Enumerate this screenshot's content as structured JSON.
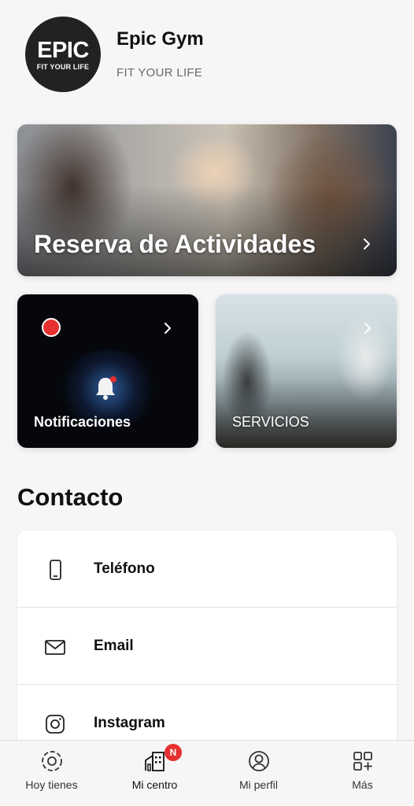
{
  "header": {
    "logo_main": "EPIC",
    "logo_sub": "FIT YOUR LIFE",
    "gym_name": "Epic Gym",
    "tagline": "FIT YOUR LIFE"
  },
  "cards": {
    "reserva": {
      "title": "Reserva de Actividades"
    },
    "notificaciones": {
      "title": "Notificaciones"
    },
    "servicios": {
      "title": "SERVICIOS"
    }
  },
  "contact": {
    "title": "Contacto",
    "items": [
      {
        "label": "Teléfono",
        "icon": "phone-icon"
      },
      {
        "label": "Email",
        "icon": "mail-icon"
      },
      {
        "label": "Instagram",
        "icon": "instagram-icon"
      }
    ]
  },
  "tabbar": {
    "items": [
      {
        "label": "Hoy tienes",
        "icon": "target-icon"
      },
      {
        "label": "Mi centro",
        "icon": "building-icon",
        "badge": "N"
      },
      {
        "label": "Mi perfil",
        "icon": "user-circle-icon"
      },
      {
        "label": "Más",
        "icon": "grid-plus-icon"
      }
    ]
  },
  "colors": {
    "accent_red": "#e63030",
    "background": "#f6f6f7"
  }
}
